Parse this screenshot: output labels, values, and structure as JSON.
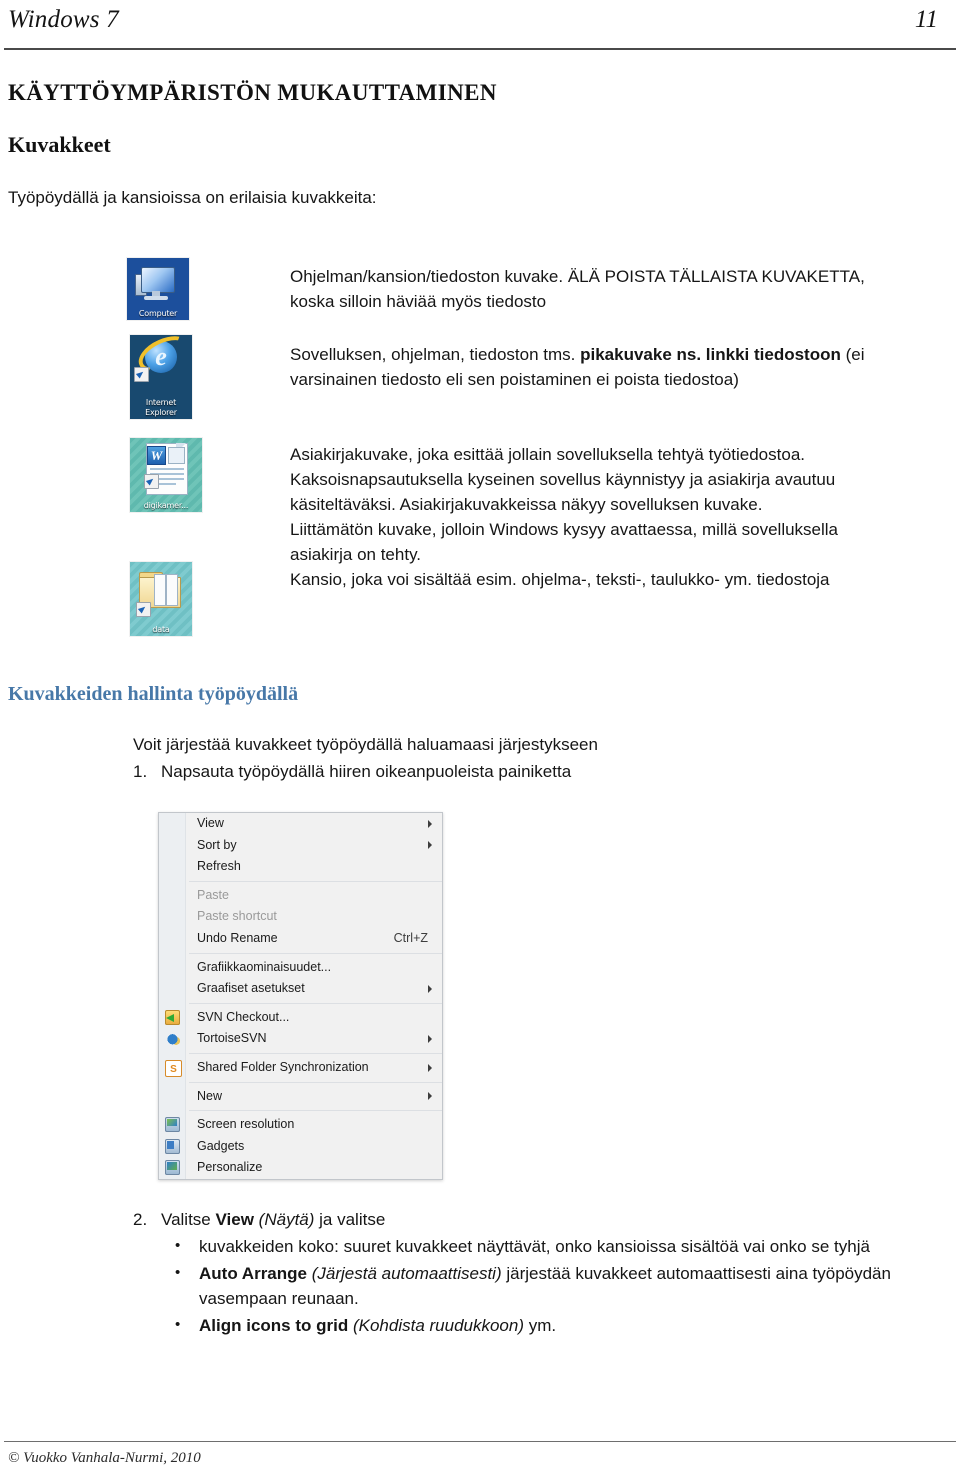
{
  "header": {
    "title": "Windows 7",
    "page_number": "11",
    "rule_color": "#4a4a4a"
  },
  "headings": {
    "h1": "KÄYTTÖYMPÄRISTÖN MUKAUTTAMINEN",
    "h2": "Kuvakkeet",
    "lead": "Työpöydällä ja kansioissa on erilaisia kuvakkeita:",
    "section": "Kuvakkeiden hallinta työpöydällä",
    "section_color": "#4778A8"
  },
  "icon_table": {
    "rows": [
      {
        "icon_name": "computer-desktop-icon",
        "icon_label": "Computer",
        "lines": [
          "Ohjelman/kansion/tiedoston kuvake. ÄLÄ POISTA TÄLLAISTA KUVAKETTA,",
          "koska silloin häviää myös tiedosto"
        ]
      },
      {
        "icon_name": "internet-explorer-shortcut-icon",
        "icon_label_1": "Internet",
        "icon_label_2": "Explorer",
        "text_before": "Sovelluksen, ohjelman, tiedoston tms. ",
        "text_bold": "pikakuvake ns. linkki tiedostoon",
        "text_after": " (ei varsinainen tiedosto eli sen poistaminen ei poista tiedostoa)"
      },
      {
        "icon_name": "word-document-shortcut-icon",
        "icon_label": "digikamer...",
        "icon_letter": "W",
        "lines": [
          "Asiakirjakuvake, joka esittää jollain sovelluksella tehtyä työtiedostoa.",
          "Kaksoisnapsautuksella kyseinen sovellus käynnistyy ja asiakirja avautuu",
          "käsiteltäväksi. Asiakirjakuvakkeissa näkyy sovelluksen kuvake.",
          "Liittämätön kuvake, jolloin Windows kysyy avattaessa, millä sovelluksella",
          "asiakirja on tehty."
        ]
      },
      {
        "icon_name": "folder-shortcut-icon",
        "icon_label": "data",
        "lines": [
          "Kansio, joka voi sisältää esim. ohjelma-, teksti-, taulukko- ym. tiedostoja"
        ]
      }
    ]
  },
  "manage_section": {
    "intro": "Voit järjestää kuvakkeet työpöydällä haluamaasi järjestykseen",
    "step1_number": "1.",
    "step1_text": "Napsauta työpöydällä hiiren oikeanpuoleista painiketta"
  },
  "context_menu": {
    "items": [
      {
        "label": "View",
        "submenu": true,
        "disabled": false,
        "icon": null,
        "shortcut": ""
      },
      {
        "label": "Sort by",
        "submenu": true,
        "disabled": false,
        "icon": null,
        "shortcut": ""
      },
      {
        "label": "Refresh",
        "submenu": false,
        "disabled": false,
        "icon": null,
        "shortcut": ""
      },
      {
        "separator": true
      },
      {
        "label": "Paste",
        "submenu": false,
        "disabled": true,
        "icon": null,
        "shortcut": ""
      },
      {
        "label": "Paste shortcut",
        "submenu": false,
        "disabled": true,
        "icon": null,
        "shortcut": ""
      },
      {
        "label": "Undo Rename",
        "submenu": false,
        "disabled": false,
        "icon": null,
        "shortcut": "Ctrl+Z"
      },
      {
        "separator": true
      },
      {
        "label": "Grafiikkaominaisuudet...",
        "submenu": false,
        "disabled": false,
        "icon": null,
        "shortcut": ""
      },
      {
        "label": "Graafiset asetukset",
        "submenu": true,
        "disabled": false,
        "icon": null,
        "shortcut": ""
      },
      {
        "separator": true
      },
      {
        "label": "SVN Checkout...",
        "submenu": false,
        "disabled": false,
        "icon": "svn-checkout-icon",
        "shortcut": ""
      },
      {
        "label": "TortoiseSVN",
        "submenu": true,
        "disabled": false,
        "icon": "tortoise-svn-icon",
        "shortcut": ""
      },
      {
        "separator": true
      },
      {
        "label": "Shared Folder Synchronization",
        "submenu": true,
        "disabled": false,
        "icon": "shared-folder-sync-icon",
        "shortcut": ""
      },
      {
        "separator": true
      },
      {
        "label": "New",
        "submenu": true,
        "disabled": false,
        "icon": null,
        "shortcut": ""
      },
      {
        "separator": true
      },
      {
        "label": "Screen resolution",
        "submenu": false,
        "disabled": false,
        "icon": "screen-resolution-icon",
        "shortcut": ""
      },
      {
        "label": "Gadgets",
        "submenu": false,
        "disabled": false,
        "icon": "gadgets-icon",
        "shortcut": ""
      },
      {
        "label": "Personalize",
        "submenu": false,
        "disabled": false,
        "icon": "personalize-icon",
        "shortcut": ""
      }
    ]
  },
  "bottom_list": {
    "step2_number": "2.",
    "step2_before": "Valitse ",
    "step2_bold": "View",
    "step2_italic": "(Näytä)",
    "step2_after": " ja valitse",
    "bullets": [
      {
        "bold": "",
        "italic": "",
        "text": "kuvakkeiden koko: suuret kuvakkeet näyttävät, onko kansioissa sisältöä vai onko se tyhjä"
      },
      {
        "bold": "Auto  Arrange ",
        "italic": "(Järjestä automaattisesti)",
        "text": " järjestää kuvakkeet automaattisesti aina työpöydän vasempaan reunaan."
      },
      {
        "bold": "Align icons to grid ",
        "italic": "(Kohdista ruudukkoon)",
        "text": " ym."
      }
    ]
  },
  "footer": {
    "copyright": "© Vuokko Vanhala-Nurmi, 2010"
  }
}
